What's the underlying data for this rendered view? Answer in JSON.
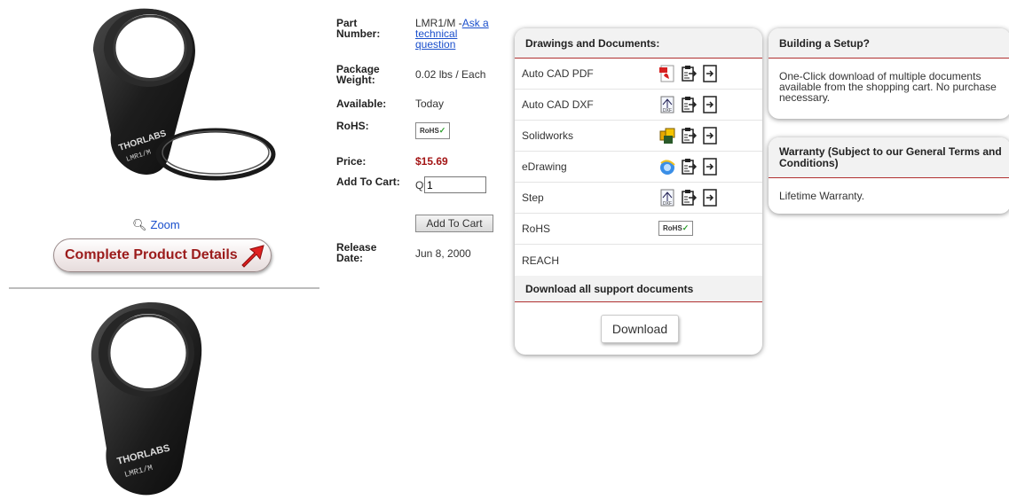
{
  "gallery": {
    "zoom_label": "Zoom",
    "details_button": "Complete Product Details",
    "brand_text": "THORLABS",
    "model_text": "LMR1/M"
  },
  "info": {
    "part_number_label": "Part Number:",
    "part_number": "LMR1/M",
    "ask_link": "Ask a technical question",
    "weight_label": "Package Weight:",
    "weight": "0.02 lbs / Each",
    "available_label": "Available:",
    "available": "Today",
    "rohs_label": "RoHS:",
    "rohs_badge": "RoHS",
    "price_label": "Price:",
    "price": "$15.69",
    "cart_label": "Add To Cart:",
    "qty_label": "Qty :",
    "qty_value": "1",
    "add_button": "Add To Cart",
    "release_label": "Release Date:",
    "release": "Jun 8, 2000"
  },
  "docs": {
    "title": "Drawings and Documents:",
    "rows": [
      {
        "name": "Auto CAD PDF",
        "icons": [
          "pdf-icon",
          "clipboard-icon",
          "document-link-icon"
        ]
      },
      {
        "name": "Auto CAD DXF",
        "icons": [
          "dxf-icon",
          "clipboard-icon",
          "document-link-icon"
        ]
      },
      {
        "name": "Solidworks",
        "icons": [
          "solidworks-icon",
          "clipboard-icon",
          "document-link-icon"
        ]
      },
      {
        "name": "eDrawing",
        "icons": [
          "edrawing-icon",
          "clipboard-icon",
          "document-link-icon"
        ]
      },
      {
        "name": "Step",
        "icons": [
          "step-icon",
          "clipboard-icon",
          "document-link-icon"
        ]
      },
      {
        "name": "RoHS",
        "icons": [
          "rohs-badge"
        ]
      },
      {
        "name": "REACH",
        "icons": []
      }
    ],
    "download_all_title": "Download all support documents",
    "download_button": "Download"
  },
  "setup": {
    "title": "Building a Setup?",
    "text": "One-Click download of multiple documents available from the shopping cart. No purchase necessary."
  },
  "warranty": {
    "title": "Warranty (Subject to our General Terms and Conditions)",
    "text": "Lifetime Warranty."
  },
  "colors": {
    "price": "#a31515",
    "link": "#1a4fcc",
    "panel_rule": "#b03030",
    "details_text": "#9b1b1b",
    "arrow": "#e02020"
  }
}
